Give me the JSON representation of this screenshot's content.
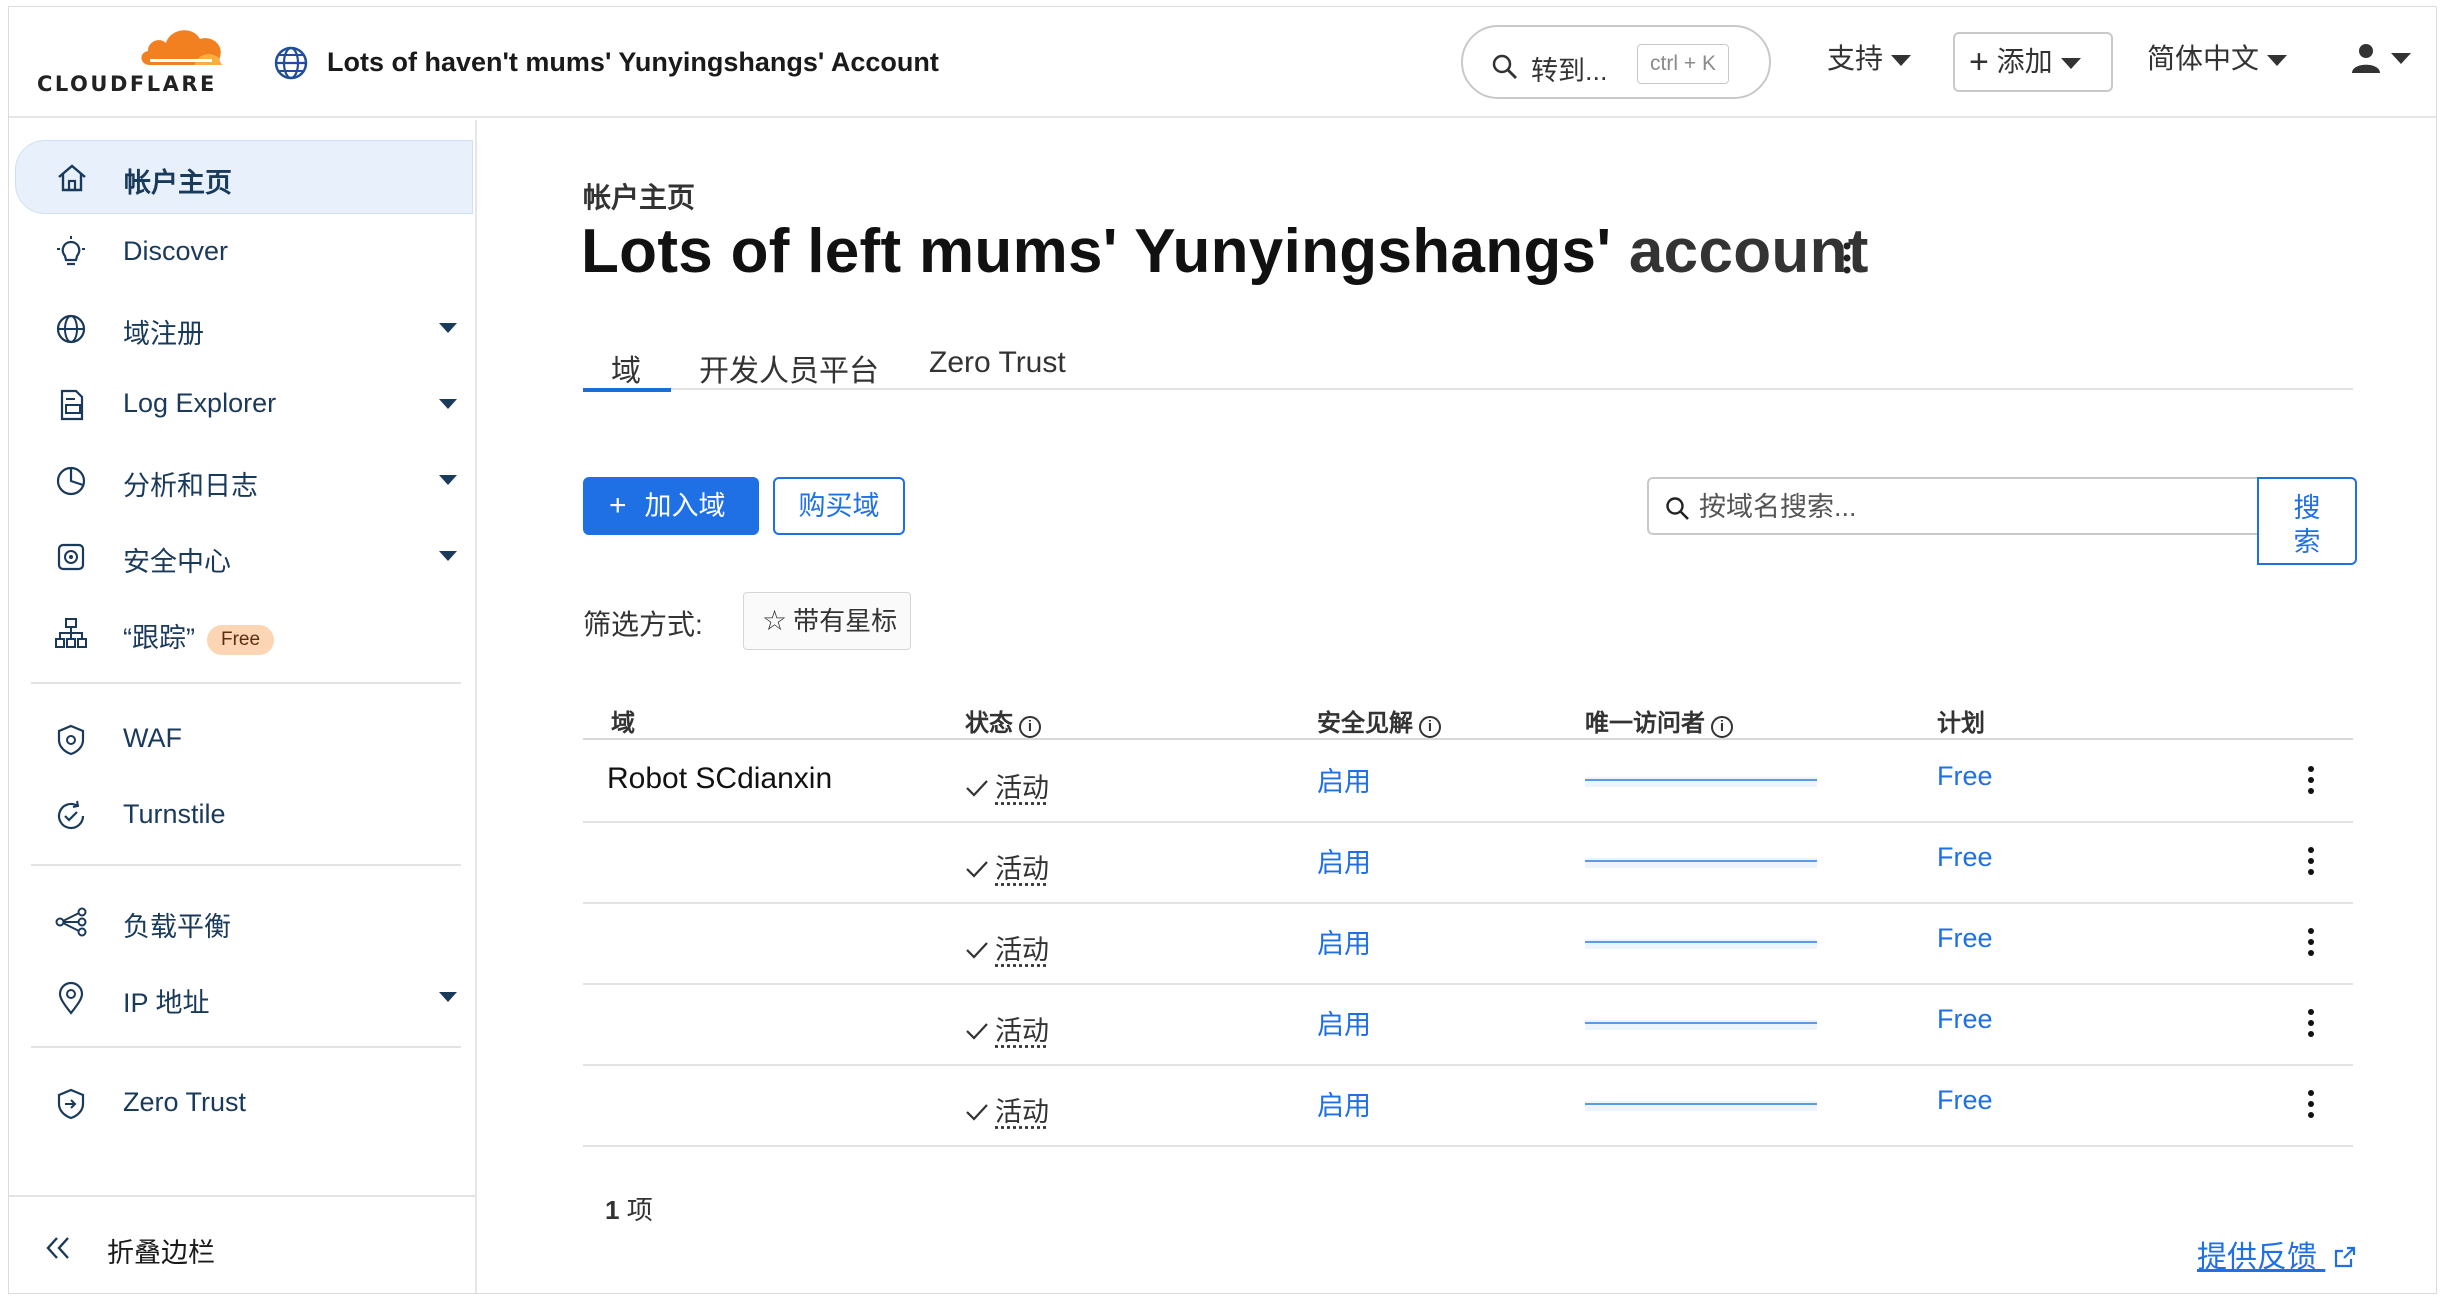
{
  "brand": {
    "logo_text": "CLOUDFLARE",
    "accent_color": "#f38020"
  },
  "header": {
    "account_title": "Lots of haven't mums' Yunyingshangs'  Account",
    "search_label": "转到...",
    "search_shortcut": "ctrl + K",
    "support_label": "支持",
    "add_label": "添加",
    "language_label": "简体中文"
  },
  "sidebar": {
    "items": [
      {
        "label": "帐户主页",
        "icon": "home-icon",
        "active": true
      },
      {
        "label": "Discover",
        "icon": "lightbulb-icon"
      },
      {
        "label": "域注册",
        "icon": "globe-icon",
        "expandable": true
      },
      {
        "label": "Log Explorer",
        "icon": "log-file-icon",
        "expandable": true
      },
      {
        "label": "分析和日志",
        "icon": "pie-chart-icon",
        "expandable": true
      },
      {
        "label": "安全中心",
        "icon": "shield-center-icon",
        "expandable": true
      },
      {
        "label": "“跟踪”",
        "icon": "network-icon",
        "badge": "Free"
      },
      {
        "label": "WAF",
        "icon": "waf-shield-icon"
      },
      {
        "label": "Turnstile",
        "icon": "turnstile-icon"
      },
      {
        "label": "负载平衡",
        "icon": "load-balance-icon"
      },
      {
        "label": "IP 地址",
        "icon": "location-pin-icon",
        "expandable": true
      },
      {
        "label": "Zero Trust",
        "icon": "zero-trust-icon"
      }
    ],
    "collapse_label": "折叠边栏"
  },
  "main": {
    "breadcrumb": "帐户主页",
    "title_main": "Lots of left mums' Yunyingshangs'",
    "title_suffix": "account",
    "tabs": [
      "域",
      "开发人员平台",
      "Zero Trust"
    ],
    "add_domain_label": "加入域",
    "buy_domain_label": "购买域",
    "search_placeholder": "按域名搜索...",
    "search_button_label": "搜索",
    "filter_label": "筛选方式:",
    "starred_label": "带有星标",
    "columns": [
      "域",
      "状态",
      "安全见解",
      "唯一访问者",
      "计划"
    ],
    "rows": [
      {
        "domain": "Robot SCdianxin",
        "status": "活动",
        "security": "启用",
        "plan": "Free"
      },
      {
        "domain": "",
        "status": "活动",
        "security": "启用",
        "plan": "Free"
      },
      {
        "domain": "",
        "status": "活动",
        "security": "启用",
        "plan": "Free"
      },
      {
        "domain": "",
        "status": "活动",
        "security": "启用",
        "plan": "Free"
      },
      {
        "domain": "",
        "status": "活动",
        "security": "启用",
        "plan": "Free"
      }
    ],
    "count_number": "1",
    "count_unit": "项",
    "feedback_label": "提供反馈"
  }
}
